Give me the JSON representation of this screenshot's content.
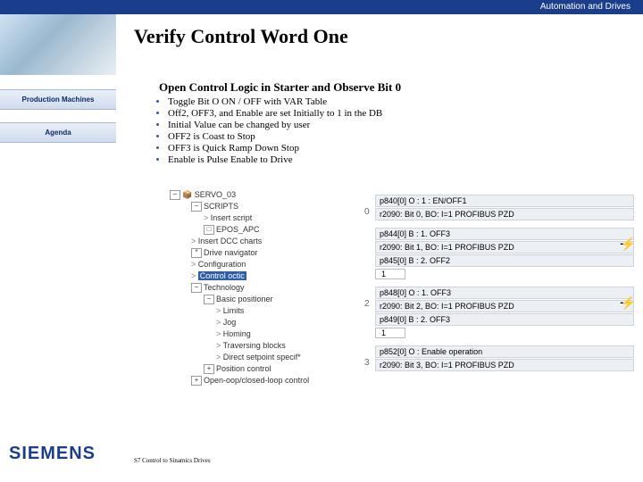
{
  "topband": "Automation and Drives",
  "title": "Verify Control Word One",
  "sidebar": {
    "items": [
      "Production Machines",
      "Agenda"
    ]
  },
  "subTitle": "Open Control Logic in Starter and Observe Bit 0",
  "bullets": [
    "Toggle Bit O ON / OFF with VAR Table",
    "Off2, OFF3, and Enable are set Initially to 1 in the DB",
    "Initial Value can be changed by user",
    "OFF2 is Coast to Stop",
    "OFF3 is Quick Ramp Down Stop",
    "Enable is Pulse Enable to Drive"
  ],
  "tree": {
    "root": "SERVO_03",
    "items": [
      {
        "t": "SCRIPTS",
        "ind": 1,
        "box": "−"
      },
      {
        "t": "Insert script",
        "ind": 2,
        "chev": ">"
      },
      {
        "t": "EPOS_APC",
        "ind": 2,
        "box": "□"
      },
      {
        "t": "Insert DCC charts",
        "ind": 1,
        "chev": ">"
      },
      {
        "t": "Drive navigator",
        "ind": 1,
        "box": "*"
      },
      {
        "t": "Configuration",
        "ind": 1,
        "chev": ">"
      },
      {
        "t": "Control octic",
        "ind": 1,
        "chev": ">",
        "hl": true
      },
      {
        "t": "Technology",
        "ind": 1,
        "box": "−"
      },
      {
        "t": "Basic positioner",
        "ind": 2,
        "box": "−"
      },
      {
        "t": "Limits",
        "ind": 3,
        "chev": ">"
      },
      {
        "t": "Jog",
        "ind": 3,
        "chev": ">"
      },
      {
        "t": "Homing",
        "ind": 3,
        "chev": ">"
      },
      {
        "t": "Traversing blocks",
        "ind": 3,
        "chev": ">"
      },
      {
        "t": "Direct setpoint specif*",
        "ind": 3,
        "chev": ">"
      },
      {
        "t": "Position control",
        "ind": 2,
        "box": "+"
      },
      {
        "t": "Open-oop/closed-loop control",
        "ind": 1,
        "box": "+"
      }
    ]
  },
  "params": [
    {
      "idx": "0",
      "lines": [
        "p840[0] O : 1 : EN/OFF1",
        "r2090: Bit 0, BO: I=1 PROFIBUS PZD"
      ]
    },
    {
      "idx": "",
      "lines": [
        "p844[0] B : 1. OFF3",
        "r2090: Bit 1, BO: I=1 PROFIBUS PZD"
      ],
      "extra": "p845[0] B : 2. OFF2",
      "val": "1",
      "glyph": true
    },
    {
      "idx": "2",
      "lines": [
        "p848[0] O : 1. OFF3",
        "r2090: Bit 2, BO: I=1 PROFIBUS PZD"
      ],
      "extra": "p849[0] B : 2. OFF3",
      "val": "1",
      "glyph": true
    },
    {
      "idx": "3",
      "lines": [
        "p852[0] O : Enable operation",
        "r2090: Bit 3, BO: I=1 PROFIBUS PZD"
      ]
    }
  ],
  "logo": "SIEMENS",
  "footerA": "S7 Control to Sinamics Drives",
  "footerB": ""
}
